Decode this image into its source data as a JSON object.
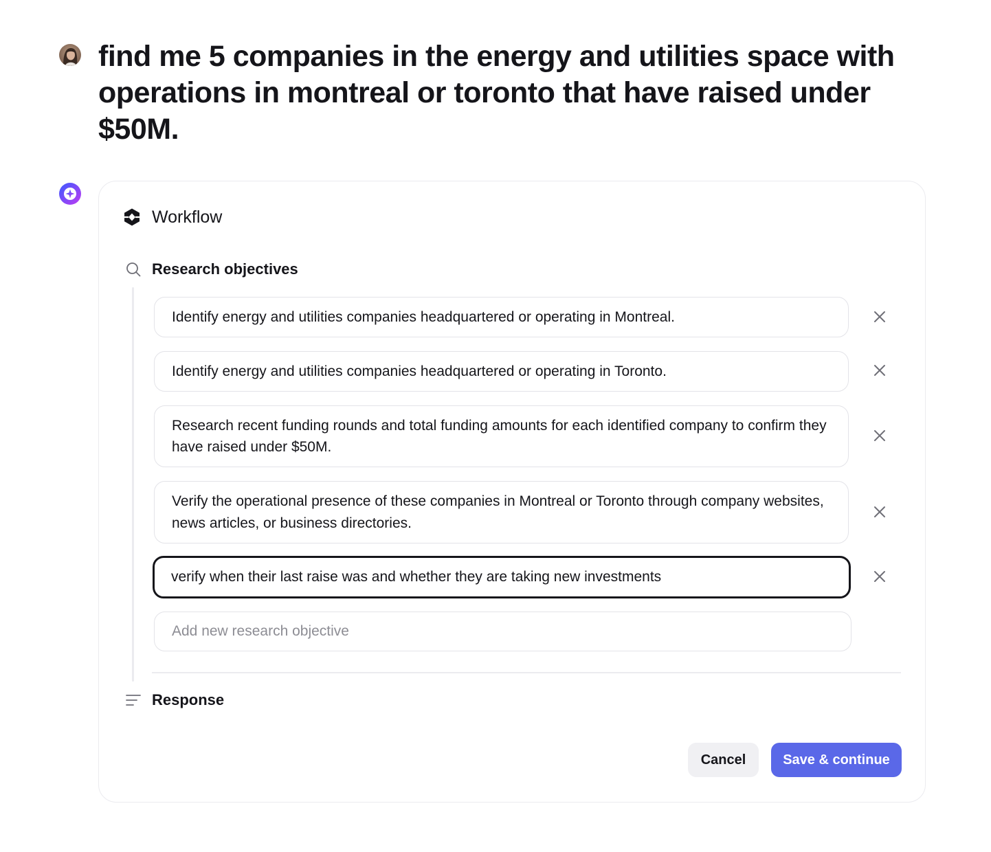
{
  "user": {
    "prompt": "find me 5 companies in the energy and utilities space with operations in montreal or toronto that have raised under $50M."
  },
  "workflow": {
    "title": "Workflow",
    "icon": "workflow-logo-icon",
    "sections": {
      "research": {
        "title": "Research objectives",
        "icon": "search-icon"
      },
      "response": {
        "title": "Response",
        "icon": "text-lines-icon"
      }
    },
    "objectives": [
      {
        "text": "Identify energy and utilities companies headquartered or operating in Montreal."
      },
      {
        "text": "Identify energy and utilities companies headquartered or operating in Toronto."
      },
      {
        "text": "Research recent funding rounds and total funding amounts for each identified company to confirm they have raised under $50M."
      },
      {
        "text": "Verify the operational presence of these companies in Montreal or Toronto through company websites, news articles, or business directories."
      },
      {
        "text": "verify when their last raise was and whether they are taking new investments"
      }
    ],
    "new_objective_placeholder": "Add new research objective",
    "buttons": {
      "cancel": "Cancel",
      "save": "Save & continue"
    }
  },
  "colors": {
    "accent": "#5a68e8",
    "assistant_avatar_gradient": [
      "#3b5bff",
      "#c03bf2"
    ]
  }
}
